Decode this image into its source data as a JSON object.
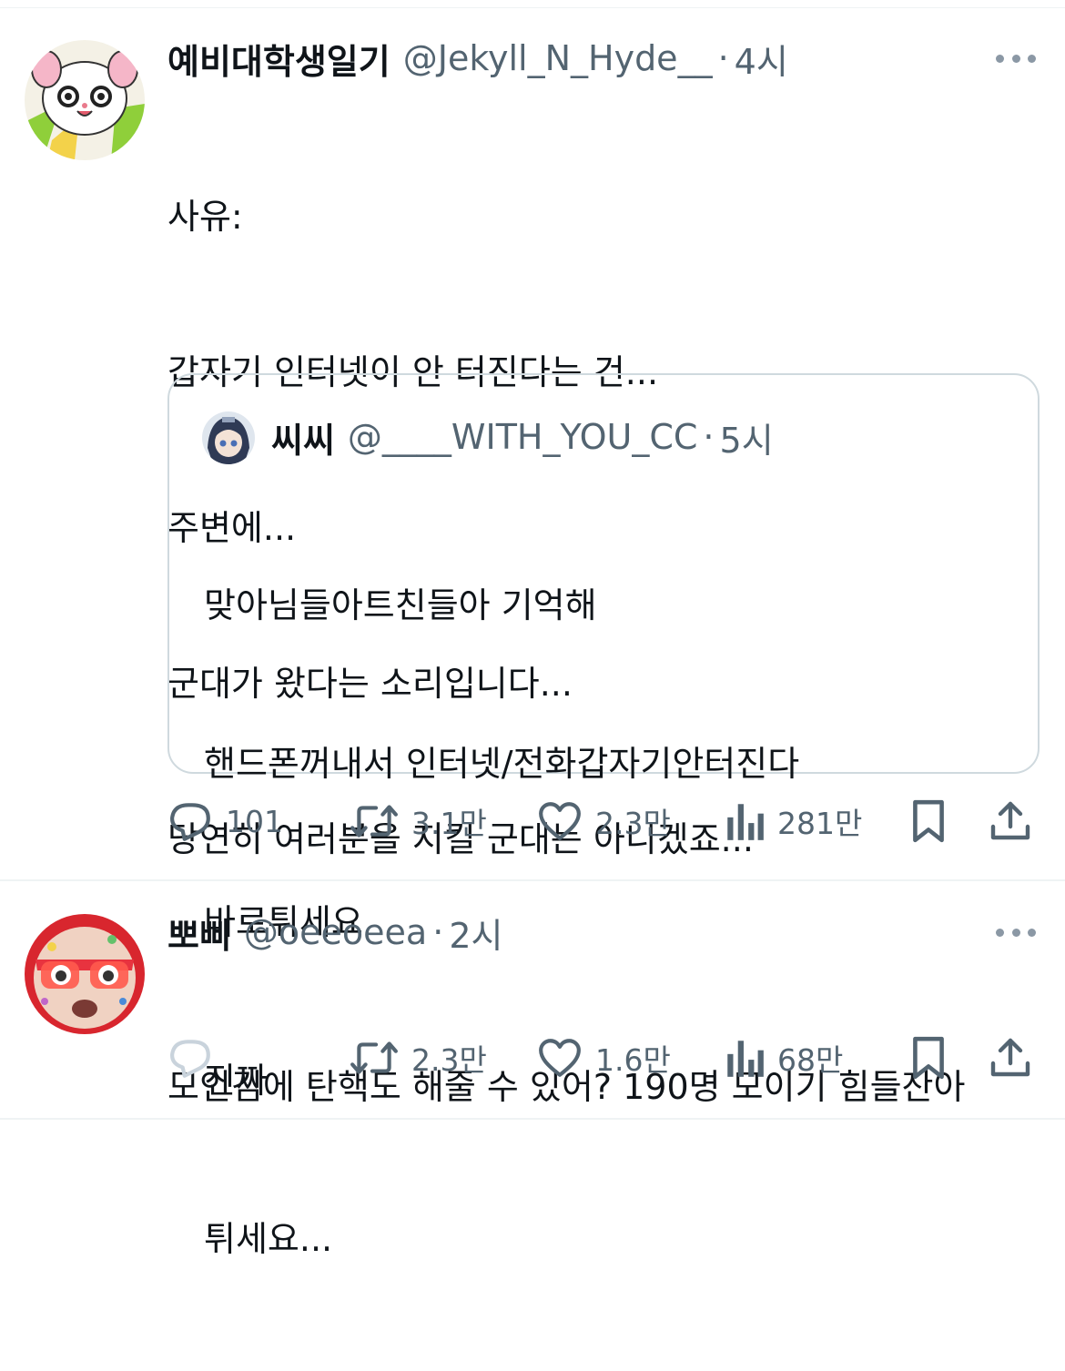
{
  "posts": [
    {
      "display_name": "예비대학생일기",
      "handle": "@Jekyll_N_Hyde__",
      "separator": "·",
      "time": "4시",
      "text_lines": [
        "사유:",
        "갑자기 인터넷이 안 터진다는 건...",
        "주변에...",
        "군대가 왔다는 소리입니다...",
        "당연히 여러분을 지킬 군대는 아니겠죠..."
      ],
      "quote": {
        "display_name": "씨씨",
        "handle": "@____WITH_YOU_CC",
        "separator": "·",
        "time": "5시",
        "text_lines": [
          "맞아님들아트친들아 기억해",
          "핸드폰꺼내서 인터넷/전화갑자기안터진다",
          "바로튀세요",
          "진짜",
          "튀세요..."
        ]
      },
      "actions": {
        "reply_count": "101",
        "repost_count": "3.1만",
        "like_count": "2.3만",
        "views_count": "281만"
      }
    },
    {
      "display_name": "뽀삐",
      "handle": "@oeeoeea",
      "separator": "·",
      "time": "2시",
      "text_lines": [
        "모인김에 탄핵도 해줄 수 있어? 190명 모이기 힘들잔아"
      ],
      "actions": {
        "reply_count": "",
        "repost_count": "2.3만",
        "like_count": "1.6만",
        "views_count": "68만"
      }
    }
  ],
  "icons": {
    "more": "more-horizontal-icon",
    "reply": "reply-bubble-icon",
    "repost": "repost-arrows-icon",
    "like": "heart-icon",
    "views": "analytics-bars-icon",
    "bookmark": "bookmark-icon",
    "share": "share-upload-icon"
  },
  "colors": {
    "text_primary": "#0f1419",
    "text_secondary": "#536471",
    "divider": "#eff3f4",
    "quote_border": "#cfd9de"
  }
}
